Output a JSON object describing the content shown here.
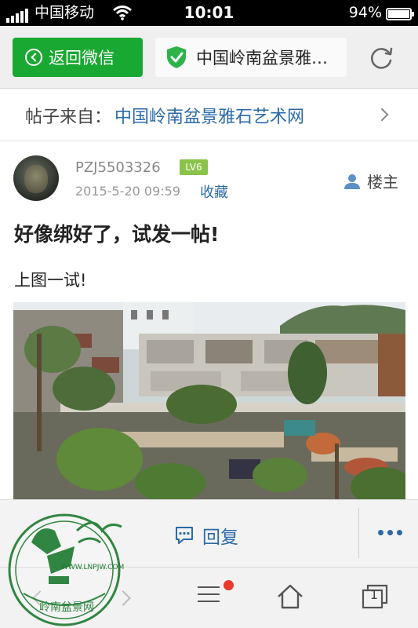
{
  "status_bar": {
    "carrier": "中国移动",
    "time": "10:01",
    "battery_percent": "94%",
    "battery_level": 0.94,
    "signal_icon": "signal-bars-icon",
    "wifi_icon": "wifi-icon"
  },
  "header": {
    "back_label": "返回微信",
    "page_title": "中国岭南盆景雅石艺术网",
    "shield_icon": "verified-shield-icon",
    "refresh_icon": "refresh-icon",
    "brand_green": "#19a832"
  },
  "source": {
    "prefix": "帖子来自：",
    "forum_name": "中国岭南盆景雅石艺术网",
    "link_color": "#2b6aa6"
  },
  "post": {
    "username": "PZJ5503326",
    "level": "LV6",
    "date": "2015-5-20 09:59",
    "favorite_label": "收藏",
    "op_label": "楼主",
    "title": "好像绑好了，试发一帖!",
    "body": "上图一试!"
  },
  "actions": {
    "reply_label": "回复",
    "more_icon": "more-dots-icon",
    "reply_icon": "comment-icon"
  },
  "browser_bar": {
    "tab_count": "1",
    "icons": [
      "back-arrow-icon",
      "forward-arrow-icon",
      "menu-icon",
      "home-icon",
      "tabs-icon"
    ]
  },
  "watermark": {
    "url_text": "WWW.LNPJW.COM",
    "logo_text": "岭南盆景网"
  }
}
